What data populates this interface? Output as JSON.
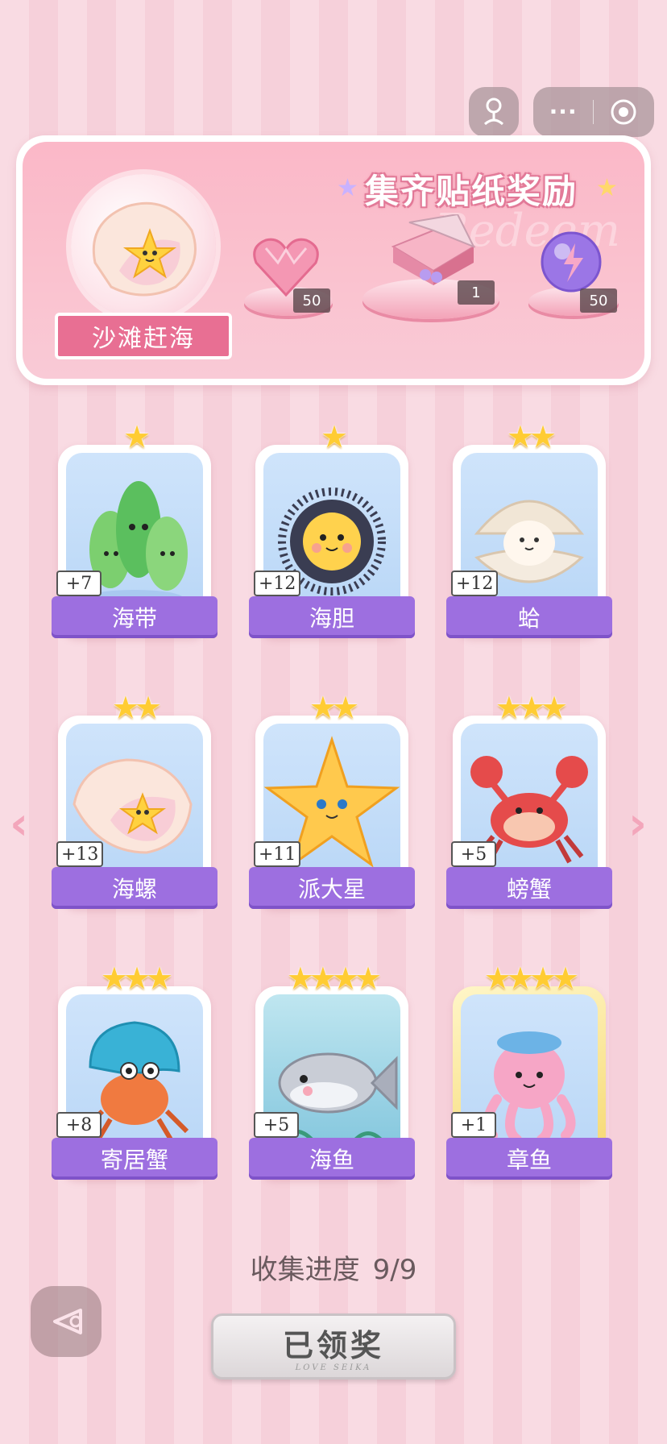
{
  "banner": {
    "title": "集齐贴纸奖励",
    "watermark": "Redeem",
    "event_label": "沙滩赶海",
    "rewards": [
      {
        "name": "heart-gem",
        "count": "50"
      },
      {
        "name": "gift-box",
        "count": "1"
      },
      {
        "name": "purple-orb",
        "count": "50"
      }
    ]
  },
  "cards": [
    {
      "name": "海带",
      "plus": "+7",
      "stars": "★",
      "icon": "seaweed-icon"
    },
    {
      "name": "海胆",
      "plus": "+12",
      "stars": "★",
      "icon": "sea-urchin-icon"
    },
    {
      "name": "蛤",
      "plus": "+12",
      "stars": "★★",
      "icon": "clam-icon"
    },
    {
      "name": "海螺",
      "plus": "+13",
      "stars": "★★",
      "icon": "conch-icon"
    },
    {
      "name": "派大星",
      "plus": "+11",
      "stars": "★★",
      "icon": "starfish-icon"
    },
    {
      "name": "螃蟹",
      "plus": "+5",
      "stars": "★★★",
      "icon": "crab-icon"
    },
    {
      "name": "寄居蟹",
      "plus": "+8",
      "stars": "★★★",
      "icon": "hermit-crab-icon"
    },
    {
      "name": "海鱼",
      "plus": "+5",
      "stars": "★★★★",
      "icon": "fish-icon"
    },
    {
      "name": "章鱼",
      "plus": "+1",
      "stars": "★★★★",
      "icon": "octopus-icon"
    }
  ],
  "progress": {
    "label": "收集进度",
    "value": "9/9"
  },
  "claim_button": {
    "label": "已领奖",
    "sub": "LOVE SEIKA"
  },
  "capsule": {
    "more": "···"
  }
}
